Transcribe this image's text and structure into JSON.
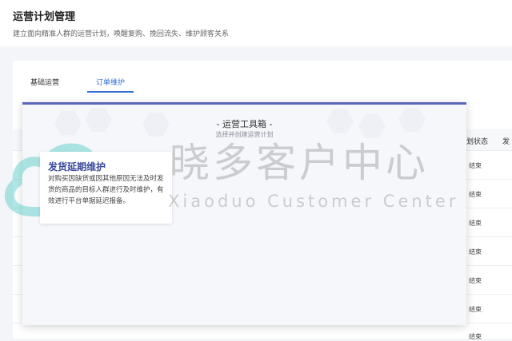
{
  "header": {
    "title": "运营计划管理",
    "subtitle": "建立面向精准人群的运营计划，唤醒复购、挽回流失、维护顾客关系"
  },
  "tabs": [
    {
      "label": "基础运营",
      "active": false
    },
    {
      "label": "订单维护",
      "active": true
    }
  ],
  "table": {
    "columns": [
      "划状态",
      "发"
    ],
    "cells": [
      "结束",
      "结束",
      "结束",
      "结束",
      "结束",
      "结束",
      "结束"
    ]
  },
  "modal": {
    "title": "- 运营工具箱 -",
    "subtitle": "选择并创建运营计划",
    "tool": {
      "title": "发货延期维护",
      "description": "对购买因缺货或因其他原因无法及时发货的商品的目标人群进行及时维护，有效进行平台单据延迟报备。"
    }
  },
  "watermark": {
    "cn": "晓多客户中心",
    "en": "Xiaoduo Customer Center"
  },
  "colors": {
    "accent": "#2f6fd6",
    "modal_border": "#5a67b8",
    "watermark_cloud": "#4cc9c0"
  }
}
